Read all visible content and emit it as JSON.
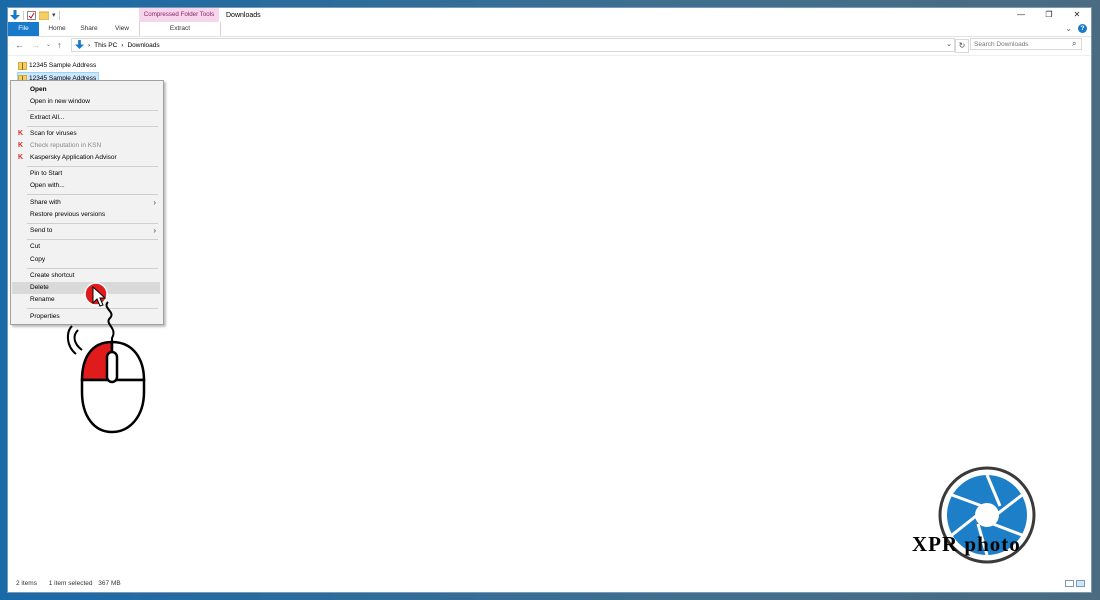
{
  "window": {
    "title": "Downloads",
    "contextual_tab_group": "Compressed Folder Tools"
  },
  "ribbon": {
    "tabs": [
      "File",
      "Home",
      "Share",
      "View",
      "Extract"
    ]
  },
  "address": {
    "breadcrumb": [
      "This PC",
      "Downloads"
    ],
    "search_placeholder": "Search Downloads"
  },
  "files": [
    {
      "name": "12345 Sample Address",
      "selected": false
    },
    {
      "name": "12345 Sample Address",
      "selected": true
    }
  ],
  "context_menu": {
    "items": [
      {
        "label": "Open",
        "bold": true
      },
      {
        "label": "Open in new window"
      },
      {
        "label": "Extract All..."
      },
      {
        "label": "Scan for viruses",
        "icon": "kaspersky-icon"
      },
      {
        "label": "Check reputation in KSN",
        "icon": "kaspersky-icon",
        "disabled": true
      },
      {
        "label": "Kaspersky Application Advisor",
        "icon": "kaspersky-icon"
      },
      {
        "label": "Pin to Start"
      },
      {
        "label": "Open with..."
      },
      {
        "label": "Share with",
        "submenu": true
      },
      {
        "label": "Restore previous versions"
      },
      {
        "label": "Send to",
        "submenu": true
      },
      {
        "label": "Cut"
      },
      {
        "label": "Copy"
      },
      {
        "label": "Create shortcut"
      },
      {
        "label": "Delete",
        "highlighted": true
      },
      {
        "label": "Rename"
      },
      {
        "label": "Properties"
      }
    ]
  },
  "status": {
    "item_count": "2 items",
    "selection": "1 item selected",
    "size": "367 MB"
  },
  "logo": {
    "text": "XPR photo"
  },
  "colors": {
    "accent": "#1979ca",
    "contextual_tab": "#f6d6ec",
    "kaspersky": "#d62a2a",
    "mouse_red": "#e01b1b"
  }
}
